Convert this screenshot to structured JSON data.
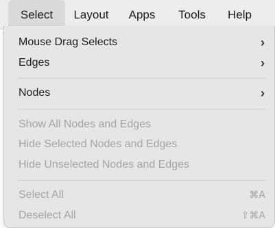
{
  "menubar": {
    "items": [
      {
        "label": "Select",
        "active": true
      },
      {
        "label": "Layout"
      },
      {
        "label": "Apps"
      },
      {
        "label": "Tools"
      },
      {
        "label": "Help"
      }
    ]
  },
  "menu": {
    "mouse_drag_selects": {
      "label": "Mouse Drag Selects",
      "submenu_icon": "chevron-right-icon",
      "enabled": true
    },
    "edges": {
      "label": "Edges",
      "submenu_icon": "chevron-right-icon",
      "enabled": true
    },
    "nodes": {
      "label": "Nodes",
      "submenu_icon": "chevron-right-icon",
      "enabled": true
    },
    "show_all": {
      "label": "Show All Nodes and Edges",
      "enabled": false
    },
    "hide_selected": {
      "label": "Hide Selected Nodes and Edges",
      "enabled": false
    },
    "hide_unselected": {
      "label": "Hide Unselected Nodes and Edges",
      "enabled": false
    },
    "select_all": {
      "label": "Select All",
      "shortcut": "⌘A",
      "enabled": false
    },
    "deselect_all": {
      "label": "Deselect All",
      "shortcut": "⇧⌘A",
      "enabled": false
    }
  },
  "colors": {
    "menubar_bg": "#ededed",
    "menu_bg": "#e6e6e6",
    "active_item_bg": "#dadada",
    "enabled_text": "#1d1d1d",
    "disabled_text": "#a4a4a4"
  }
}
